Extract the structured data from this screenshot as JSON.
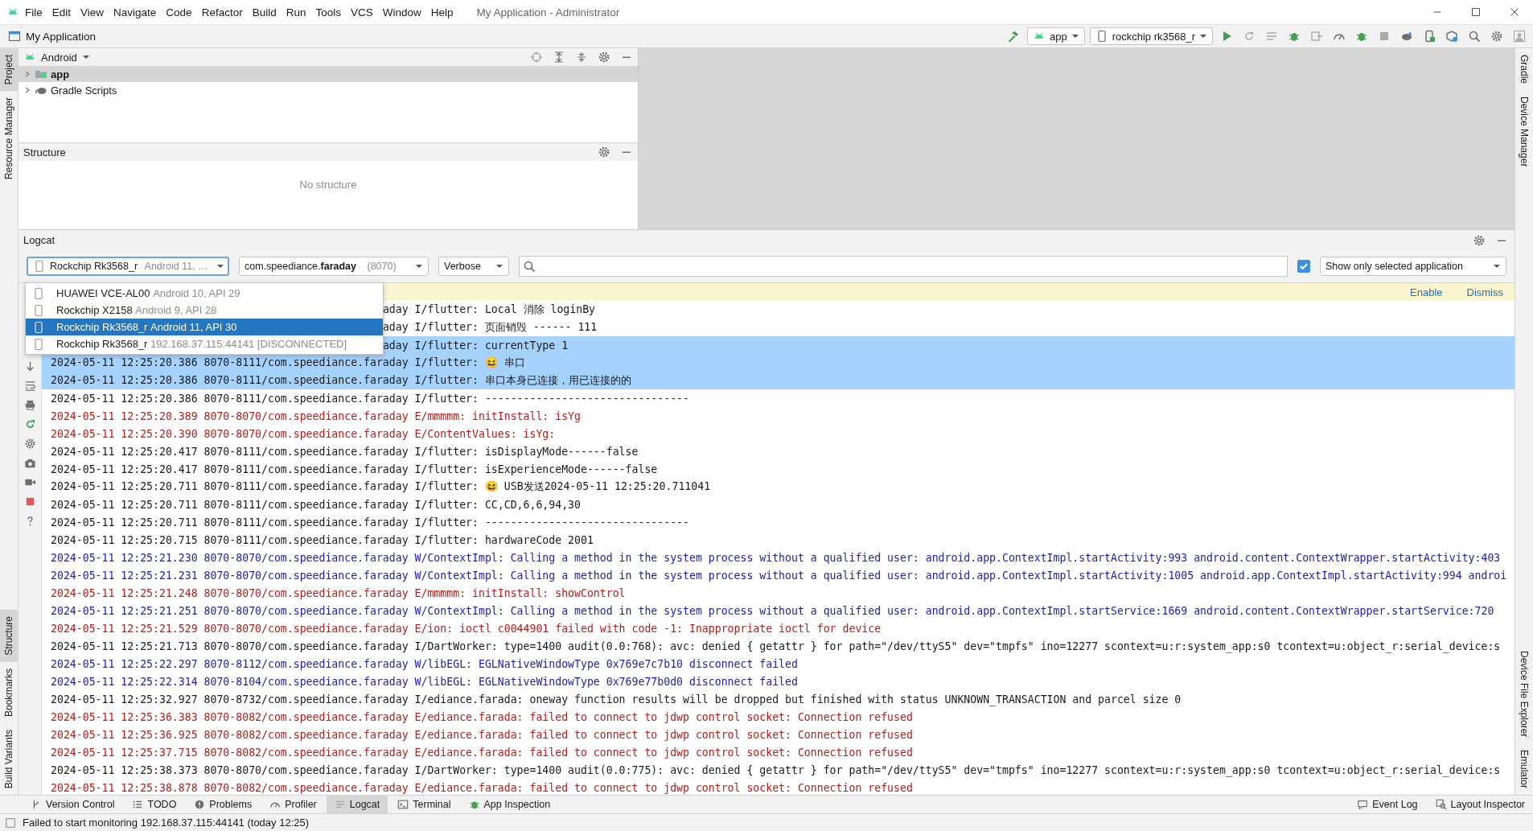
{
  "title_bar": {
    "menus": [
      "File",
      "Edit",
      "View",
      "Navigate",
      "Code",
      "Refactor",
      "Build",
      "Run",
      "Tools",
      "VCS",
      "Window",
      "Help"
    ],
    "title": "My Application - Administrator"
  },
  "nav_bar": {
    "project": "My Application",
    "run_config": "app",
    "device": "rockchip rk3568_r"
  },
  "left_stripe": {
    "top": [
      {
        "label": "Project",
        "selected": true
      },
      {
        "label": "Resource Manager",
        "selected": false
      }
    ],
    "bottom": [
      {
        "label": "Structure",
        "selected": true
      },
      {
        "label": "Bookmarks",
        "selected": false
      },
      {
        "label": "Build Variants",
        "selected": false
      }
    ]
  },
  "right_stripe": {
    "top": [
      {
        "label": "Gradle",
        "selected": false
      },
      {
        "label": "Device Manager",
        "selected": false
      }
    ],
    "bottom": [
      {
        "label": "Device File Explorer",
        "selected": false
      },
      {
        "label": "Emulator",
        "selected": false
      }
    ]
  },
  "project_panel": {
    "view": "Android",
    "tree": [
      {
        "label": "app",
        "expanded": false,
        "selected": true
      },
      {
        "label": "Gradle Scripts",
        "expanded": false,
        "selected": false
      }
    ]
  },
  "structure_panel": {
    "title": "Structure",
    "empty_text": "No structure"
  },
  "logcat": {
    "title": "Logcat",
    "device": {
      "name": "Rockchip Rk3568_r",
      "detail": "Android 11, …"
    },
    "package": {
      "name": "com.speediance.**faraday**",
      "pid": "(8070)"
    },
    "log_level": "Verbose",
    "only_selected": {
      "checked": true,
      "label": "Show only selected application"
    },
    "device_menu": [
      {
        "name": "HUAWEI VCE-AL00",
        "detail": "Android 10, API 29",
        "selected": false
      },
      {
        "name": "Rockchip X2158",
        "detail": "Android 9, API 28",
        "selected": false
      },
      {
        "name": "Rockchip Rk3568_r",
        "detail": "Android 11, API 30",
        "selected": true
      },
      {
        "name": "Rockchip Rk3568_r",
        "detail": "192.168.37.115:44141 [DISCONNECTED]",
        "selected": false
      }
    ],
    "banner": {
      "actions": [
        "Enable",
        "Dismiss"
      ]
    },
    "lines": [
      {
        "kind": "info",
        "covered": true,
        "selected": false,
        "text": "aday I/flutter: Local 消除 loginBy"
      },
      {
        "kind": "info",
        "covered": true,
        "selected": false,
        "text": "aday I/flutter: 页面销毁 ------ 111"
      },
      {
        "kind": "info",
        "covered": true,
        "selected": true,
        "text": "aday I/flutter: currentType 1"
      },
      {
        "kind": "info",
        "covered": false,
        "selected": true,
        "text": "2024-05-11 12:25:20.386 8070-8111/com.speediance.faraday I/flutter: 😆 串口"
      },
      {
        "kind": "info",
        "covered": false,
        "selected": true,
        "text": "2024-05-11 12:25:20.386 8070-8111/com.speediance.faraday I/flutter: 串口本身已连接，用已连接的的"
      },
      {
        "kind": "info",
        "covered": false,
        "selected": false,
        "text": "2024-05-11 12:25:20.386 8070-8111/com.speediance.faraday I/flutter: --------------------------------"
      },
      {
        "kind": "error",
        "covered": false,
        "selected": false,
        "text": "2024-05-11 12:25:20.389 8070-8070/com.speediance.faraday E/mmmmm: initInstall: isYg"
      },
      {
        "kind": "error",
        "covered": false,
        "selected": false,
        "text": "2024-05-11 12:25:20.390 8070-8070/com.speediance.faraday E/ContentValues: isYg:"
      },
      {
        "kind": "info",
        "covered": false,
        "selected": false,
        "text": "2024-05-11 12:25:20.417 8070-8111/com.speediance.faraday I/flutter: isDisplayMode------false"
      },
      {
        "kind": "info",
        "covered": false,
        "selected": false,
        "text": "2024-05-11 12:25:20.417 8070-8111/com.speediance.faraday I/flutter: isExperienceMode------false"
      },
      {
        "kind": "info",
        "covered": false,
        "selected": false,
        "text": "2024-05-11 12:25:20.711 8070-8111/com.speediance.faraday I/flutter: 😆 USB发送2024-05-11 12:25:20.711041"
      },
      {
        "kind": "info",
        "covered": false,
        "selected": false,
        "text": "2024-05-11 12:25:20.711 8070-8111/com.speediance.faraday I/flutter: CC,CD,6,6,94,30"
      },
      {
        "kind": "info",
        "covered": false,
        "selected": false,
        "text": "2024-05-11 12:25:20.711 8070-8111/com.speediance.faraday I/flutter: --------------------------------"
      },
      {
        "kind": "info",
        "covered": false,
        "selected": false,
        "text": "2024-05-11 12:25:20.715 8070-8111/com.speediance.faraday I/flutter: hardwareCode 2001"
      },
      {
        "kind": "warn",
        "covered": false,
        "selected": false,
        "text": "2024-05-11 12:25:21.230 8070-8070/com.speediance.faraday W/ContextImpl: Calling a method in the system process without a qualified user: android.app.ContextImpl.startActivity:993 android.content.ContextWrapper.startActivity:403"
      },
      {
        "kind": "warn",
        "covered": false,
        "selected": false,
        "text": "2024-05-11 12:25:21.231 8070-8070/com.speediance.faraday W/ContextImpl: Calling a method in the system process without a qualified user: android.app.ContextImpl.startActivity:1005 android.app.ContextImpl.startActivity:994 androi"
      },
      {
        "kind": "error",
        "covered": false,
        "selected": false,
        "text": "2024-05-11 12:25:21.248 8070-8070/com.speediance.faraday E/mmmmm: initInstall: showControl"
      },
      {
        "kind": "warn",
        "covered": false,
        "selected": false,
        "text": "2024-05-11 12:25:21.251 8070-8070/com.speediance.faraday W/ContextImpl: Calling a method in the system process without a qualified user: android.app.ContextImpl.startService:1669 android.content.ContextWrapper.startService:720"
      },
      {
        "kind": "error",
        "covered": false,
        "selected": false,
        "text": "2024-05-11 12:25:21.529 8070-8070/com.speediance.faraday E/ion: ioctl c0044901 failed with code -1: Inappropriate ioctl for device"
      },
      {
        "kind": "info",
        "covered": false,
        "selected": false,
        "text": "2024-05-11 12:25:21.713 8070-8070/com.speediance.faraday I/DartWorker: type=1400 audit(0.0:768): avc: denied { getattr } for path=\"/dev/ttyS5\" dev=\"tmpfs\" ino=12277 scontext=u:r:system_app:s0 tcontext=u:object_r:serial_device:s"
      },
      {
        "kind": "warn",
        "covered": false,
        "selected": false,
        "text": "2024-05-11 12:25:22.297 8070-8112/com.speediance.faraday W/libEGL: EGLNativeWindowType 0x769e7c7b10 disconnect failed"
      },
      {
        "kind": "warn",
        "covered": false,
        "selected": false,
        "text": "2024-05-11 12:25:22.314 8070-8104/com.speediance.faraday W/libEGL: EGLNativeWindowType 0x769e77b0d0 disconnect failed"
      },
      {
        "kind": "info",
        "covered": false,
        "selected": false,
        "text": "2024-05-11 12:25:32.927 8070-8732/com.speediance.faraday I/ediance.farada: oneway function results will be dropped but finished with status UNKNOWN_TRANSACTION and parcel size 0"
      },
      {
        "kind": "error",
        "covered": false,
        "selected": false,
        "text": "2024-05-11 12:25:36.383 8070-8082/com.speediance.faraday E/ediance.farada: failed to connect to jdwp control socket: Connection refused"
      },
      {
        "kind": "error",
        "covered": false,
        "selected": false,
        "text": "2024-05-11 12:25:36.925 8070-8082/com.speediance.faraday E/ediance.farada: failed to connect to jdwp control socket: Connection refused"
      },
      {
        "kind": "error",
        "covered": false,
        "selected": false,
        "text": "2024-05-11 12:25:37.715 8070-8082/com.speediance.faraday E/ediance.farada: failed to connect to jdwp control socket: Connection refused"
      },
      {
        "kind": "info",
        "covered": false,
        "selected": false,
        "text": "2024-05-11 12:25:38.373 8070-8070/com.speediance.faraday I/DartWorker: type=1400 audit(0.0:775): avc: denied { getattr } for path=\"/dev/ttyS5\" dev=\"tmpfs\" ino=12277 scontext=u:r:system_app:s0 tcontext=u:object_r:serial_device:s"
      },
      {
        "kind": "error",
        "covered": false,
        "selected": false,
        "text": "2024-05-11 12:25:38.878 8070-8082/com.speediance.faraday E/ediance.farada: failed to connect to jdwp control socket: Connection refused"
      }
    ]
  },
  "tool_tabs": [
    {
      "label": "Version Control",
      "selected": false
    },
    {
      "label": "TODO",
      "selected": false
    },
    {
      "label": "Problems",
      "selected": false
    },
    {
      "label": "Profiler",
      "selected": false
    },
    {
      "label": "Logcat",
      "selected": true
    },
    {
      "label": "Terminal",
      "selected": false
    },
    {
      "label": "App Inspection",
      "selected": false
    }
  ],
  "right_tools": [
    "Event Log",
    "Layout Inspector"
  ],
  "status_bar": {
    "message": "Failed to start monitoring 192.168.37.115:44141 (today 12:25)"
  }
}
